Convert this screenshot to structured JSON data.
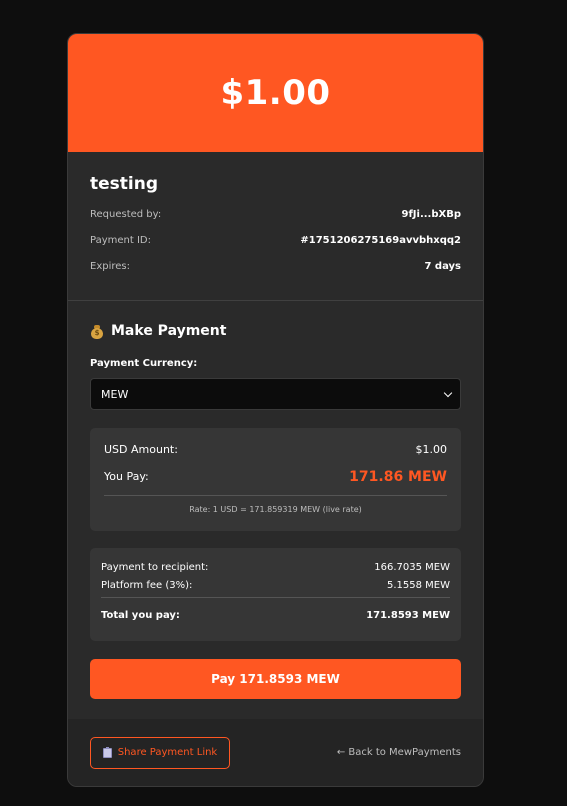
{
  "banner": {
    "amount": "$1.00"
  },
  "request": {
    "title": "testing",
    "rows": [
      {
        "label": "Requested by:",
        "value": "9fJi...bXBp"
      },
      {
        "label": "Payment ID:",
        "value": "#1751206275169avvbhxqq2"
      },
      {
        "label": "Expires:",
        "value": "7 days"
      }
    ]
  },
  "payment": {
    "section_title": "Make Payment",
    "section_icon": "money-bag-icon",
    "currency_label": "Payment Currency:",
    "currency_selected": "MEW",
    "usd_label": "USD Amount:",
    "usd_value": "$1.00",
    "you_pay_label": "You Pay:",
    "you_pay_value": "171.86 MEW",
    "rate_text": "Rate: 1 USD = 171.859319 MEW (live rate)",
    "fees": {
      "recipient_label": "Payment to recipient:",
      "recipient_value": "166.7035 MEW",
      "platform_label": "Platform fee (3%):",
      "platform_value": "5.1558 MEW",
      "total_label": "Total you pay:",
      "total_value": "171.8593 MEW"
    },
    "pay_button": "Pay 171.8593 MEW"
  },
  "footer": {
    "share_label": "Share Payment Link",
    "share_icon": "clipboard-icon",
    "back_label": "← Back to MewPayments"
  },
  "colors": {
    "accent": "#ff5722",
    "card_bg": "#2a2a2a",
    "page_bg": "#0e0e0e"
  }
}
